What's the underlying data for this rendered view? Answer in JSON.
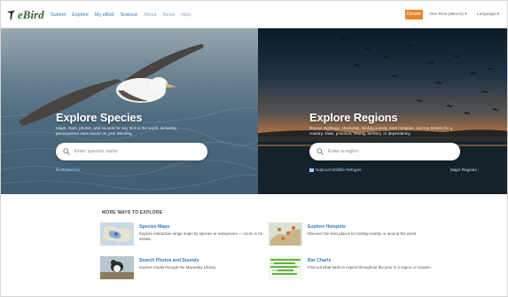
{
  "header": {
    "logo_text": "eBird",
    "nav": [
      {
        "label": "Submit"
      },
      {
        "label": "Explore"
      },
      {
        "label": "My eBird"
      },
      {
        "label": "Science"
      },
      {
        "label": "About"
      },
      {
        "label": "News"
      },
      {
        "label": "Help"
      }
    ],
    "donate_label": "Donate",
    "sign_in_label": "Alex Rios (alexrio) ▾",
    "language_label": "Language ▾"
  },
  "hero_left": {
    "title": "Explore Species",
    "description": "Maps, stats, photos, and sounds for any bird in the world, including personalized stats based on your eBirding.",
    "search_placeholder": "Enter species name",
    "link": "Illustrated list"
  },
  "hero_right": {
    "title": "Explore Regions",
    "description": "Recent sightings, checklists, birding activity, best hotspots, and top birders for a country, state, province, county, territory, or dependency.",
    "search_placeholder": "Enter a region",
    "link_left": "National Wildlife Refuges",
    "link_right": "Major Regions ›"
  },
  "more_ways": {
    "heading": "MORE WAYS TO EXPLORE",
    "cards": [
      {
        "title": "Species Maps",
        "description": "Explore interactive range maps by species or subspecies — zoom in for details."
      },
      {
        "title": "Explore Hotspots",
        "description": "Discover the best places for birding nearby or around the world."
      },
      {
        "title": "Search Photos and Sounds",
        "description": "Explore media through the Macaulay Library."
      },
      {
        "title": "Bar Charts",
        "description": "Find out what birds to expect throughout the year in a region or location."
      }
    ]
  },
  "colors": {
    "link": "#2f78c4",
    "donate": "#e8862a",
    "logo": "#3a6b2b"
  }
}
